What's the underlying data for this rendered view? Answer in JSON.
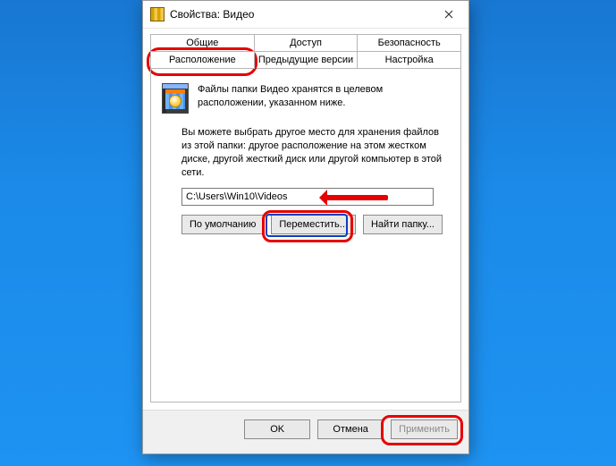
{
  "window": {
    "title": "Свойства: Видео"
  },
  "tabs": {
    "row1": [
      "Общие",
      "Доступ",
      "Безопасность"
    ],
    "row2": [
      "Расположение",
      "Предыдущие версии",
      "Настройка"
    ],
    "active": "Расположение"
  },
  "panel": {
    "intro": "Файлы папки Видео хранятся в целевом расположении, указанном ниже.",
    "desc": "Вы можете выбрать другое место для хранения файлов из этой папки: другое расположение на этом жестком диске, другой жесткий диск или другой компьютер в этой сети.",
    "path": "C:\\Users\\Win10\\Videos",
    "btn_default": "По умолчанию",
    "btn_move": "Переместить...",
    "btn_find": "Найти папку..."
  },
  "footer": {
    "ok": "OK",
    "cancel": "Отмена",
    "apply": "Применить"
  }
}
